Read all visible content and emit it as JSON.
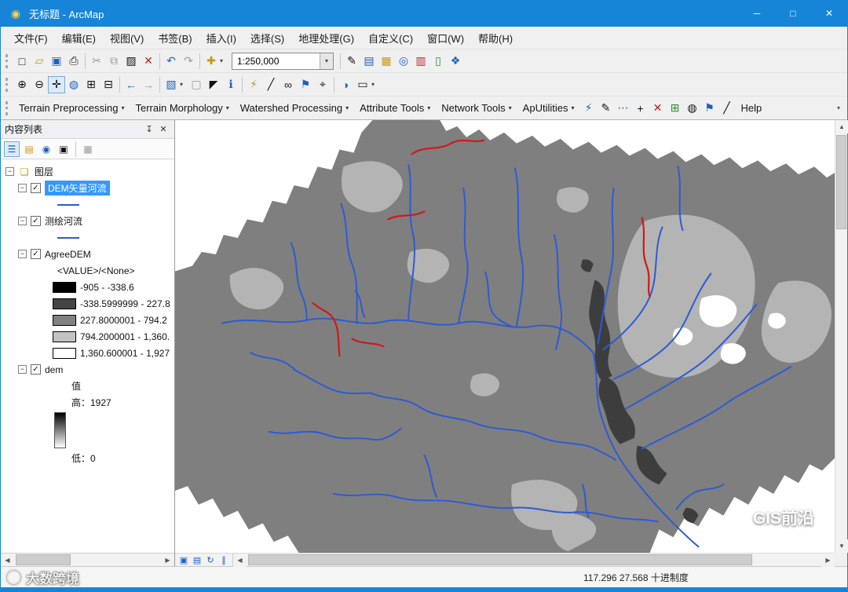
{
  "window": {
    "title": "无标题 - ArcMap"
  },
  "menu": {
    "items": [
      "文件(F)",
      "编辑(E)",
      "视图(V)",
      "书签(B)",
      "插入(I)",
      "选择(S)",
      "地理处理(G)",
      "自定义(C)",
      "窗口(W)",
      "帮助(H)"
    ]
  },
  "standard_toolbar": {
    "scale_value": "1:250,000"
  },
  "archydro": {
    "menus": [
      "Terrain Preprocessing",
      "Terrain Morphology",
      "Watershed Processing",
      "Attribute Tools",
      "Network Tools",
      "ApUtilities"
    ],
    "help_label": "Help"
  },
  "toc": {
    "title": "内容列表",
    "root_label": "图层",
    "layers": {
      "dem_vector": "DEM矢量河流",
      "surveyed": "测绘河流",
      "agreedem": "AgreeDEM",
      "agreedem_field": "<VALUE>/<None>",
      "dem": "dem",
      "dem_value_label": "值",
      "dem_high": "高：1927",
      "dem_low": "低：0"
    },
    "agreedem_classes": [
      {
        "label": "-905 - -338.6",
        "color": "#000000"
      },
      {
        "label": "-338.5999999 - 227.8",
        "color": "#454545"
      },
      {
        "label": "227.8000001 - 794.2",
        "color": "#818181"
      },
      {
        "label": "794.2000001 - 1,360.",
        "color": "#c3c3c3"
      },
      {
        "label": "1,360.600001 - 1,927",
        "color": "#ffffff"
      }
    ]
  },
  "statusbar": {
    "coordinates": "117.296 27.568 十进制度"
  },
  "watermarks": {
    "left": "大数跨境",
    "right": "GIS前沿"
  },
  "colors": {
    "titlebar": "#1785d7",
    "selection": "#3598ff",
    "river_blue": "#2d5bd3",
    "river_red": "#d01818",
    "land_gray": "#7f7f7f"
  },
  "icons": {
    "app": "◉",
    "minimize": "─",
    "maximize": "□",
    "close": "✕",
    "dropdown": "▾",
    "check": "✓",
    "expand_minus": "−",
    "new": "□",
    "open": "▱",
    "save": "▣",
    "print": "⎙",
    "cut": "✂",
    "copy": "⧉",
    "paste": "▨",
    "delete": "✕",
    "undo": "↶",
    "redo": "↷",
    "add_data": "✚",
    "editor": "✎",
    "toc_win": "▤",
    "catalog": "▦",
    "search": "◎",
    "toolbox": "▥",
    "python": "▯",
    "model": "❖",
    "zoom_in": "⊕",
    "zoom_out": "⊖",
    "pan": "✛",
    "globe": "◍",
    "fixed_in": "⊞",
    "fixed_out": "⊟",
    "back": "←",
    "forward": "→",
    "select_features": "▧",
    "clear_sel": "▢",
    "select_arrow": "◤",
    "identify": "ℹ",
    "popup": "⚡",
    "measure": "╱",
    "find": "∞",
    "route": "⚑",
    "xy": "⌖",
    "time": "◑",
    "viewer": "▭",
    "refresh": "↻",
    "pause": "∥",
    "pin": "↧",
    "scroll_left": "◀",
    "scroll_right": "▶",
    "scroll_up": "▲",
    "scroll_down": "▼",
    "list_draw": "☰",
    "list_source": "▤",
    "list_visible": "◉",
    "list_select": "▣",
    "options": "▦",
    "flash": "⚡",
    "pencil": "✎",
    "dots": "⋯",
    "plus": "+",
    "red_x": "✕",
    "net": "⊞",
    "globe2": "◍",
    "flag": "⚑",
    "slash": "╱",
    "data_view": "▣",
    "layout_view": "▤",
    "data_frame": "❏"
  }
}
